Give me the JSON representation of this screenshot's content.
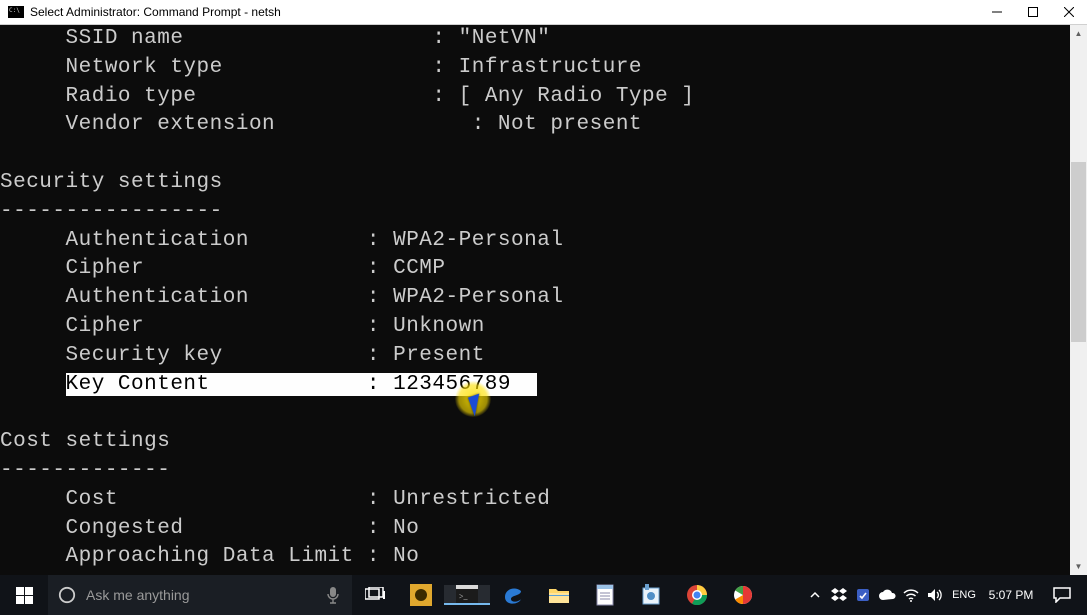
{
  "window": {
    "title": "Select Administrator: Command Prompt - netsh"
  },
  "profile_top": [
    {
      "label": "SSID name",
      "pad": 23,
      "colon_col": 28,
      "value": "\"NetVN\""
    },
    {
      "label": "Network type",
      "pad": 20,
      "colon_col": 28,
      "value": "Infrastructure"
    },
    {
      "label": "Radio type",
      "pad": 22,
      "colon_col": 28,
      "value": "[ Any Radio Type ]"
    },
    {
      "label": "Vendor extension",
      "pad": 16,
      "colon_col": 31,
      "value": "Not present"
    }
  ],
  "security": {
    "header": "Security settings",
    "divider": "-----------------",
    "rows": [
      {
        "label": "Authentication",
        "value": "WPA2-Personal"
      },
      {
        "label": "Cipher",
        "value": "CCMP"
      },
      {
        "label": "Authentication",
        "value": "WPA2-Personal"
      },
      {
        "label": "Cipher",
        "value": "Unknown"
      },
      {
        "label": "Security key",
        "value": "Present"
      },
      {
        "label": "Key Content",
        "value": "123456789",
        "selected": true
      }
    ]
  },
  "cost": {
    "header": "Cost settings",
    "divider": "-------------",
    "rows": [
      {
        "label": "Cost",
        "value": "Unrestricted"
      },
      {
        "label": "Congested",
        "value": "No"
      },
      {
        "label": "Approaching Data Limit",
        "value": "No",
        "tight": true
      }
    ]
  },
  "taskbar": {
    "search_placeholder": "Ask me anything",
    "lang": "ENG",
    "clock": "5:07 PM"
  }
}
